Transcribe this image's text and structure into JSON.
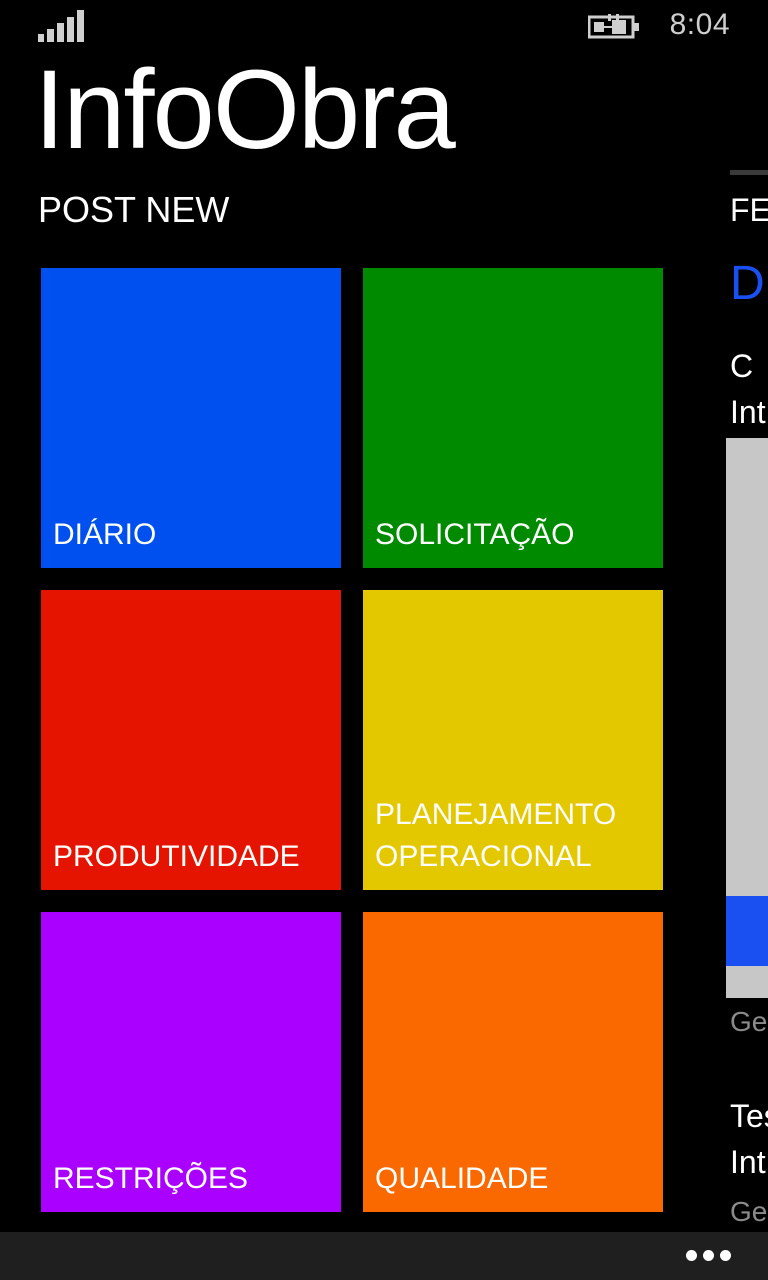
{
  "status_bar": {
    "time": "8:04",
    "signal_icon": "signal-strength-icon",
    "battery_icon": "battery-charging-icon"
  },
  "app": {
    "title": "InfoObra"
  },
  "pivot": {
    "current_header": "POST NEW",
    "next_header_peek": "FE"
  },
  "tiles": [
    {
      "label": "DIÁRIO",
      "color": "#0050EF"
    },
    {
      "label": "SOLICITAÇÃO",
      "color": "#008A00"
    },
    {
      "label": "PRODUTIVIDADE",
      "color": "#E51400"
    },
    {
      "label": "PLANEJAMENTO\nOPERACIONAL",
      "color": "#E3C800"
    },
    {
      "label": "RESTRIÇÕES",
      "color": "#AA00FF"
    },
    {
      "label": "QUALIDADE",
      "color": "#FA6800"
    }
  ],
  "peek_panel": {
    "big_letter": "D",
    "item1_title": "C",
    "item1_subtitle": "Int",
    "item1_caption": "Ge",
    "item2_title": "Tes",
    "item2_subtitle": "Int",
    "item2_caption": "Ge",
    "accent_color": "#1A4FF2"
  },
  "app_bar": {
    "more_icon": "ellipsis-more-icon"
  }
}
